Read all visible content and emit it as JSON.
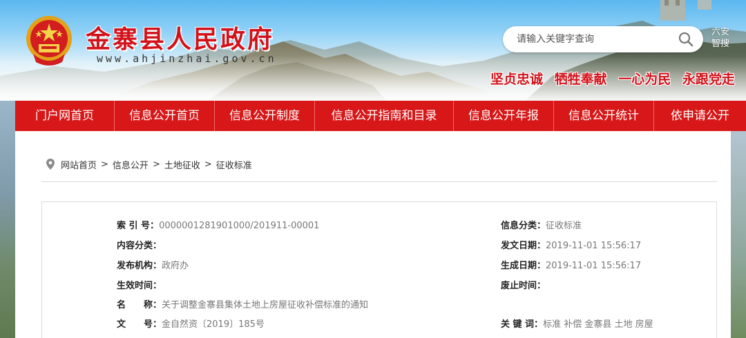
{
  "header": {
    "site_title": "金寨县人民政府",
    "site_url": "www.ahjinzhai.gov.cn",
    "search_placeholder": "请输入关键字查询",
    "smart_search_line1": "六安",
    "smart_search_line2": "智搜",
    "slogan": "坚贞忠诚 牺牲奉献 一心为民 永跟党走"
  },
  "nav": {
    "items": [
      {
        "label": "门户网首页"
      },
      {
        "label": "信息公开首页"
      },
      {
        "label": "信息公开制度"
      },
      {
        "label": "信息公开指南和目录"
      },
      {
        "label": "信息公开年报"
      },
      {
        "label": "信息公开统计"
      },
      {
        "label": "依申请公开"
      }
    ]
  },
  "breadcrumb": {
    "items": [
      "网站首页",
      "信息公开",
      "土地征收",
      "征收标准"
    ],
    "separator": ">"
  },
  "info": {
    "index_no": {
      "label": "索 引 号：",
      "value": "000000128190100​0/201911-00001"
    },
    "content_category": {
      "label": "内容分类：",
      "value": ""
    },
    "publisher": {
      "label": "发布机构：",
      "value": "政府办"
    },
    "effective_time": {
      "label": "生效时间：",
      "value": ""
    },
    "name": {
      "label": "名　　称：",
      "value": "关于调整金寨县集体土地上房屋征收补偿标准的通知"
    },
    "doc_no": {
      "label": "文　　号：",
      "value": "金自然资〔2019〕185号"
    },
    "info_category": {
      "label": "信息分类：",
      "value": "征收标准"
    },
    "issue_date": {
      "label": "发文日期：",
      "value": "2019-11-01 15:56:17"
    },
    "created_date": {
      "label": "生成日期：",
      "value": "2019-11-01 15:56:17"
    },
    "abolish_time": {
      "label": "废止时间：",
      "value": ""
    },
    "keywords": {
      "label": "关 键 词：",
      "value": "标准 补偿 金寨县 土地 房屋"
    }
  },
  "colors": {
    "brand_red": "#d71718",
    "title_red": "#d2121a"
  }
}
